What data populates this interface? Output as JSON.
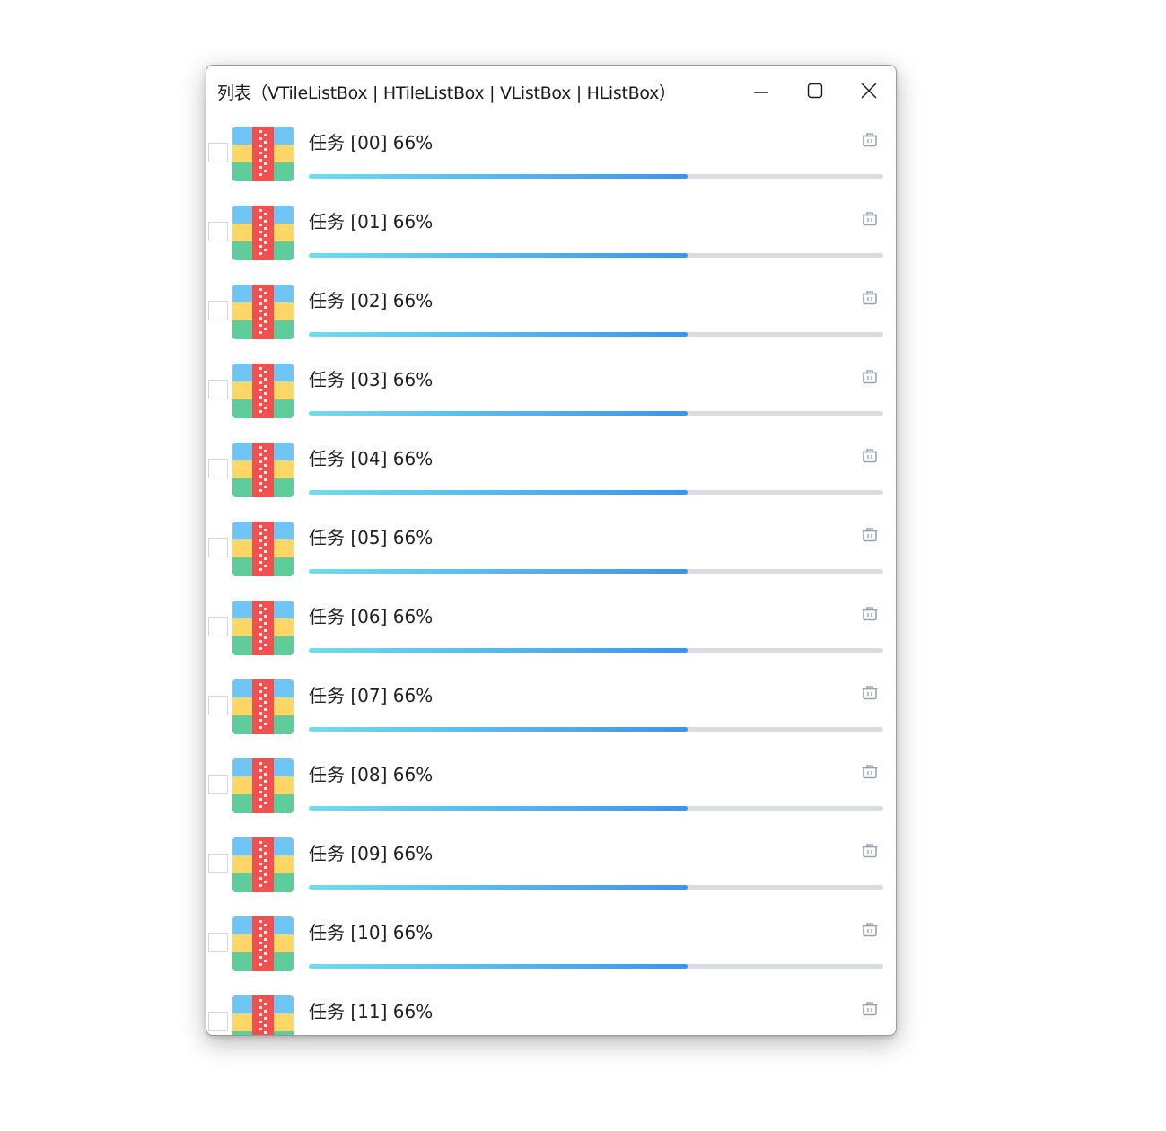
{
  "window": {
    "title": "列表（VTileListBox | HTileListBox | VListBox | HListBox）"
  },
  "icons": {
    "minimize": "minimize-icon",
    "maximize": "maximize-icon",
    "close": "close-icon",
    "item": "zip-archive-icon",
    "delete": "trash-icon"
  },
  "colors": {
    "progress_start": "#6fdcef",
    "progress_end": "#3a95f0",
    "progress_track": "#d9dde2"
  },
  "tasks": [
    {
      "label": "任务 [00] 66%",
      "progress": 0.66
    },
    {
      "label": "任务 [01] 66%",
      "progress": 0.66
    },
    {
      "label": "任务 [02] 66%",
      "progress": 0.66
    },
    {
      "label": "任务 [03] 66%",
      "progress": 0.66
    },
    {
      "label": "任务 [04] 66%",
      "progress": 0.66
    },
    {
      "label": "任务 [05] 66%",
      "progress": 0.66
    },
    {
      "label": "任务 [06] 66%",
      "progress": 0.66
    },
    {
      "label": "任务 [07] 66%",
      "progress": 0.66
    },
    {
      "label": "任务 [08] 66%",
      "progress": 0.66
    },
    {
      "label": "任务 [09] 66%",
      "progress": 0.66
    },
    {
      "label": "任务 [10] 66%",
      "progress": 0.66
    },
    {
      "label": "任务 [11] 66%",
      "progress": 0.66
    }
  ]
}
